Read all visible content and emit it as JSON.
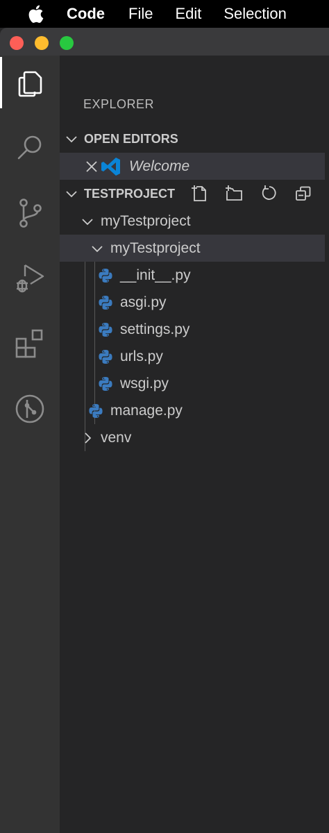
{
  "menubar": {
    "app_name": "Code",
    "items": [
      "File",
      "Edit",
      "Selection"
    ]
  },
  "activity_bar": {
    "items": [
      "explorer-icon",
      "search-icon",
      "source-control-icon",
      "run-debug-icon",
      "extensions-icon",
      "git-graph-icon"
    ]
  },
  "sidebar": {
    "title": "EXPLORER",
    "open_editors": {
      "label": "OPEN EDITORS",
      "items": [
        {
          "label": "Welcome"
        }
      ]
    },
    "project": {
      "label": "TESTPROJECT",
      "tree": {
        "root_folder": "myTestproject",
        "sub_folder": "myTestproject",
        "files": [
          "__init__.py",
          "asgi.py",
          "settings.py",
          "urls.py",
          "wsgi.py"
        ],
        "root_file": "manage.py",
        "venv": "venv"
      }
    }
  },
  "colors": {
    "activity_bar": "#333333",
    "sidebar": "#252526",
    "selection": "#37373d",
    "python_icon": "#3b7bbf",
    "vscode_blue": "#0a84d6"
  }
}
